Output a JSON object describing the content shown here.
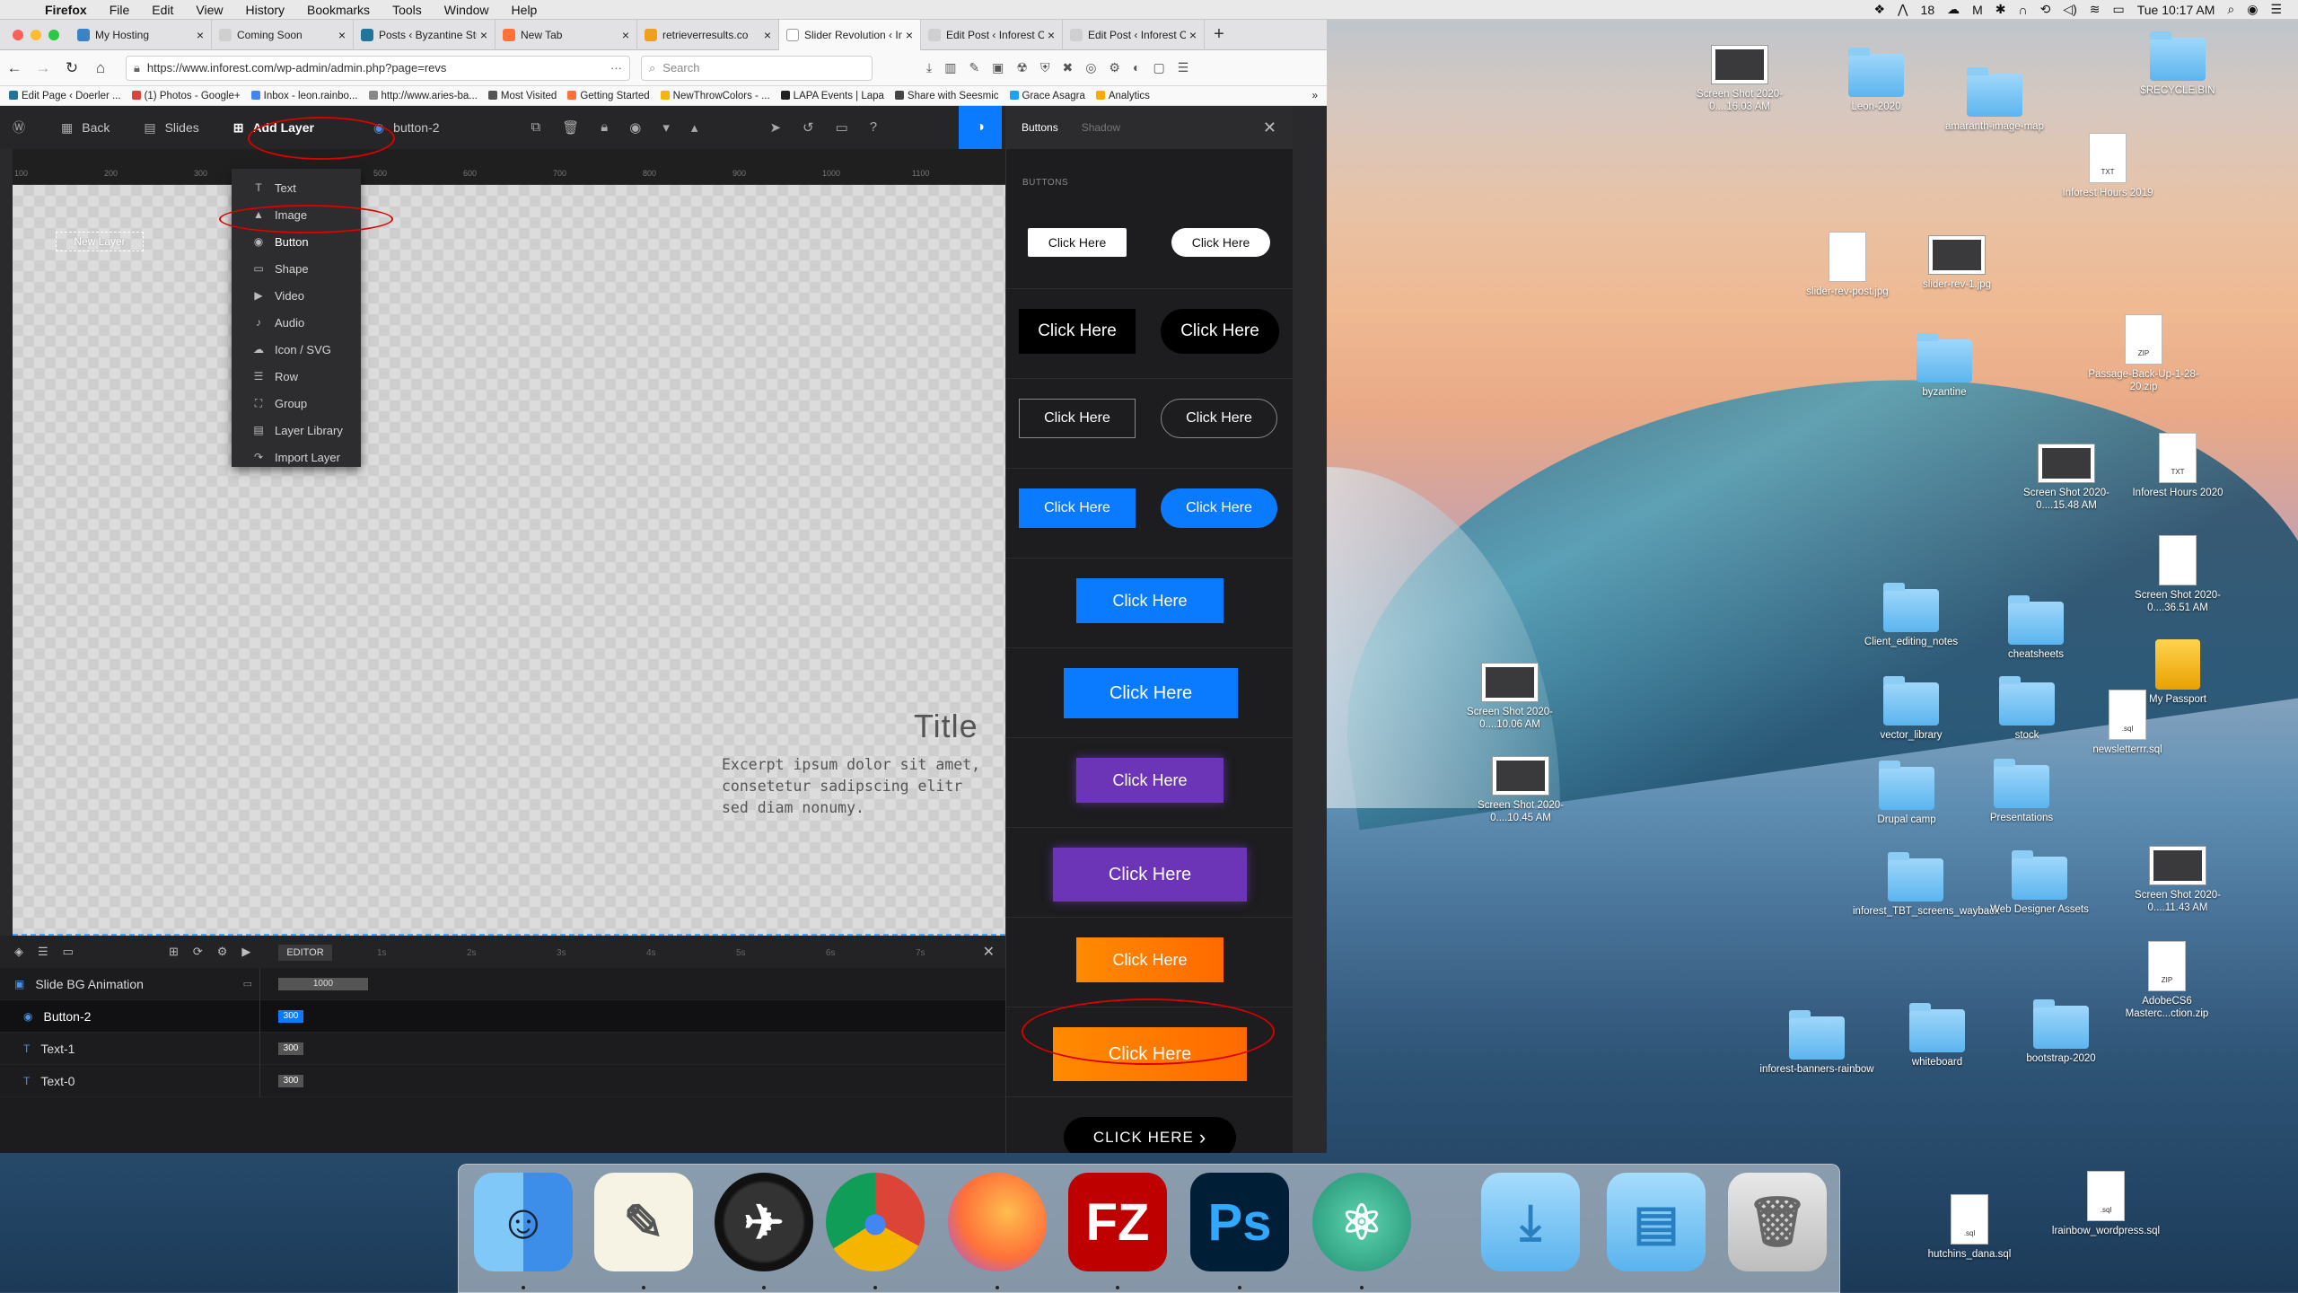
{
  "menubar": {
    "app": "Firefox",
    "items": [
      "File",
      "Edit",
      "View",
      "History",
      "Bookmarks",
      "Tools",
      "Window",
      "Help"
    ],
    "status_count": "18",
    "clock": "Tue 10:17 AM"
  },
  "tabs": [
    {
      "label": "My Hosting",
      "color": "#3a83c4"
    },
    {
      "label": "Coming Soon",
      "color": "#cfcfcf"
    },
    {
      "label": "Posts ‹ Byzantine Stud",
      "color": "#21759b"
    },
    {
      "label": "New Tab",
      "color": "#ff7139"
    },
    {
      "label": "retrieverresults.co",
      "color": "#f0a020"
    },
    {
      "label": "Slider Revolution ‹ Info",
      "color": "#ffffff",
      "active": true
    },
    {
      "label": "Edit Post ‹ Inforest Co",
      "color": "#cfcfcf"
    },
    {
      "label": "Edit Post ‹ Inforest Co",
      "color": "#cfcfcf"
    }
  ],
  "nav": {
    "url": "https://www.inforest.com/wp-admin/admin.php?page=revs",
    "search_placeholder": "Search"
  },
  "bookmarks": [
    {
      "label": "Edit Page ‹ Doerler ...",
      "color": "#21759b"
    },
    {
      "label": "(1) Photos - Google+",
      "color": "#db4437"
    },
    {
      "label": "Inbox - leon.rainbo...",
      "color": "#4285f4"
    },
    {
      "label": "http://www.aries-ba...",
      "color": "#888888"
    },
    {
      "label": "Most Visited",
      "color": "#555555"
    },
    {
      "label": "Getting Started",
      "color": "#ff7139"
    },
    {
      "label": "NewThrowColors - ...",
      "color": "#f4b400"
    },
    {
      "label": "LAPA Events | Lapa",
      "color": "#222222"
    },
    {
      "label": "Share with Seesmic",
      "color": "#444444"
    },
    {
      "label": "Grace Asagra",
      "color": "#1da1f2"
    },
    {
      "label": "Analytics",
      "color": "#f9ab00"
    }
  ],
  "editor": {
    "back": "Back",
    "slides": "Slides",
    "add_layer": "Add Layer",
    "layer_name": "button-2",
    "panel_tab_active": "Buttons",
    "panel_tab_inactive": "Shadow",
    "panel_section": "BUTTONS"
  },
  "ruler_marks": [
    "100",
    "200",
    "300",
    "400",
    "500",
    "600",
    "700",
    "800",
    "900",
    "1000",
    "1100"
  ],
  "add_layer_menu": [
    {
      "label": "Text",
      "icon": "text-icon",
      "glyph": "T"
    },
    {
      "label": "Image",
      "icon": "image-icon",
      "glyph": "▲"
    },
    {
      "label": "Button",
      "icon": "button-icon",
      "glyph": "◉",
      "selected": true
    },
    {
      "label": "Shape",
      "icon": "shape-icon",
      "glyph": "▭"
    },
    {
      "label": "Video",
      "icon": "video-icon",
      "glyph": "▶"
    },
    {
      "label": "Audio",
      "icon": "audio-icon",
      "glyph": "♪"
    },
    {
      "label": "Icon / SVG",
      "icon": "svg-icon",
      "glyph": "☁"
    },
    {
      "label": "Row",
      "icon": "row-icon",
      "glyph": "☰"
    },
    {
      "label": "Group",
      "icon": "group-icon",
      "glyph": "⛶"
    },
    {
      "label": "Layer Library",
      "icon": "library-icon",
      "glyph": "▤"
    },
    {
      "label": "Import Layer",
      "icon": "import-icon",
      "glyph": "↷"
    }
  ],
  "canvas": {
    "new_layer": "New Layer",
    "title": "Title",
    "excerpt": "Excerpt ipsum dolor sit amet, consetetur sadipscing elitr sed diam nonumy."
  },
  "timeline": {
    "editor_label": "EDITOR",
    "marks": [
      "1s",
      "2s",
      "3s",
      "4s",
      "5s",
      "6s",
      "7s"
    ],
    "rows": [
      {
        "name": "Slide BG Animation",
        "value": "1000"
      },
      {
        "name": "Button-2",
        "value": "300",
        "selected": true
      },
      {
        "name": "Text-1",
        "value": "300"
      },
      {
        "name": "Text-0",
        "value": "300"
      }
    ]
  },
  "button_label": "Click Here",
  "button_last_label": "CLICK HERE",
  "colors": {
    "blue": "#0a7bff",
    "purple": "#6c35b8",
    "orange": "#ff6a00",
    "highlight": "#d80000"
  },
  "desktop_icons": [
    {
      "label": "Screen Shot 2020-0....16.03 AM",
      "type": "shot"
    },
    {
      "label": "Leon-2020",
      "type": "folder"
    },
    {
      "label": "amaranth-image-map",
      "type": "folder"
    },
    {
      "label": "$RECYCLE.BIN",
      "type": "folder"
    },
    {
      "label": "Inforest Hours 2019",
      "type": "txt"
    },
    {
      "label": "slider-rev-post.jpg",
      "type": "doc"
    },
    {
      "label": "slider-rev-1.jpg",
      "type": "shot"
    },
    {
      "label": "byzantine",
      "type": "folder"
    },
    {
      "label": "Passage-Back-Up-1-28-20.zip",
      "type": "zip"
    },
    {
      "label": "Screen Shot 2020-0....15.48 AM",
      "type": "shot"
    },
    {
      "label": "Inforest Hours 2020",
      "type": "txt"
    },
    {
      "label": "Screen Shot 2020-0....36.51 AM",
      "type": "doc"
    },
    {
      "label": "Client_editing_notes",
      "type": "folder"
    },
    {
      "label": "cheatsheets",
      "type": "folder"
    },
    {
      "label": "My Passport",
      "type": "drive"
    },
    {
      "label": "Screen Shot 2020-0....10.06 AM",
      "type": "shot"
    },
    {
      "label": "vector_library",
      "type": "folder"
    },
    {
      "label": "stock",
      "type": "folder"
    },
    {
      "label": "newsletterrr.sql",
      "type": "sql"
    },
    {
      "label": "Screen Shot 2020-0....10.45 AM",
      "type": "shot"
    },
    {
      "label": "Drupal camp",
      "type": "folder"
    },
    {
      "label": "Presentations",
      "type": "folder"
    },
    {
      "label": "Screen Shot 2020-0....11.43 AM",
      "type": "shot"
    },
    {
      "label": "inforest_TBT_screens_wayback",
      "type": "folder"
    },
    {
      "label": "Web Designer Assets",
      "type": "folder"
    },
    {
      "label": "AdobeCS6 Masterc...ction.zip",
      "type": "zip"
    },
    {
      "label": "inforest-banners-rainbow",
      "type": "folder"
    },
    {
      "label": "whiteboard",
      "type": "folder"
    },
    {
      "label": "bootstrap-2020",
      "type": "folder"
    },
    {
      "label": "hutchins_dana.sql",
      "type": "sql"
    },
    {
      "label": "lrainbow_wordpress.sql",
      "type": "sql"
    }
  ],
  "dock": [
    {
      "name": "finder",
      "label": "Finder"
    },
    {
      "name": "textedit",
      "label": "TextEdit"
    },
    {
      "name": "network-radar",
      "label": "Network Radar"
    },
    {
      "name": "chrome",
      "label": "Chrome"
    },
    {
      "name": "firefox",
      "label": "Firefox"
    },
    {
      "name": "filezilla",
      "label": "FZ"
    },
    {
      "name": "photoshop",
      "label": "Ps"
    },
    {
      "name": "atom",
      "label": "Atom"
    },
    {
      "name": "downloads",
      "label": "Downloads"
    },
    {
      "name": "documents",
      "label": "Documents"
    },
    {
      "name": "trash",
      "label": "Trash"
    }
  ]
}
